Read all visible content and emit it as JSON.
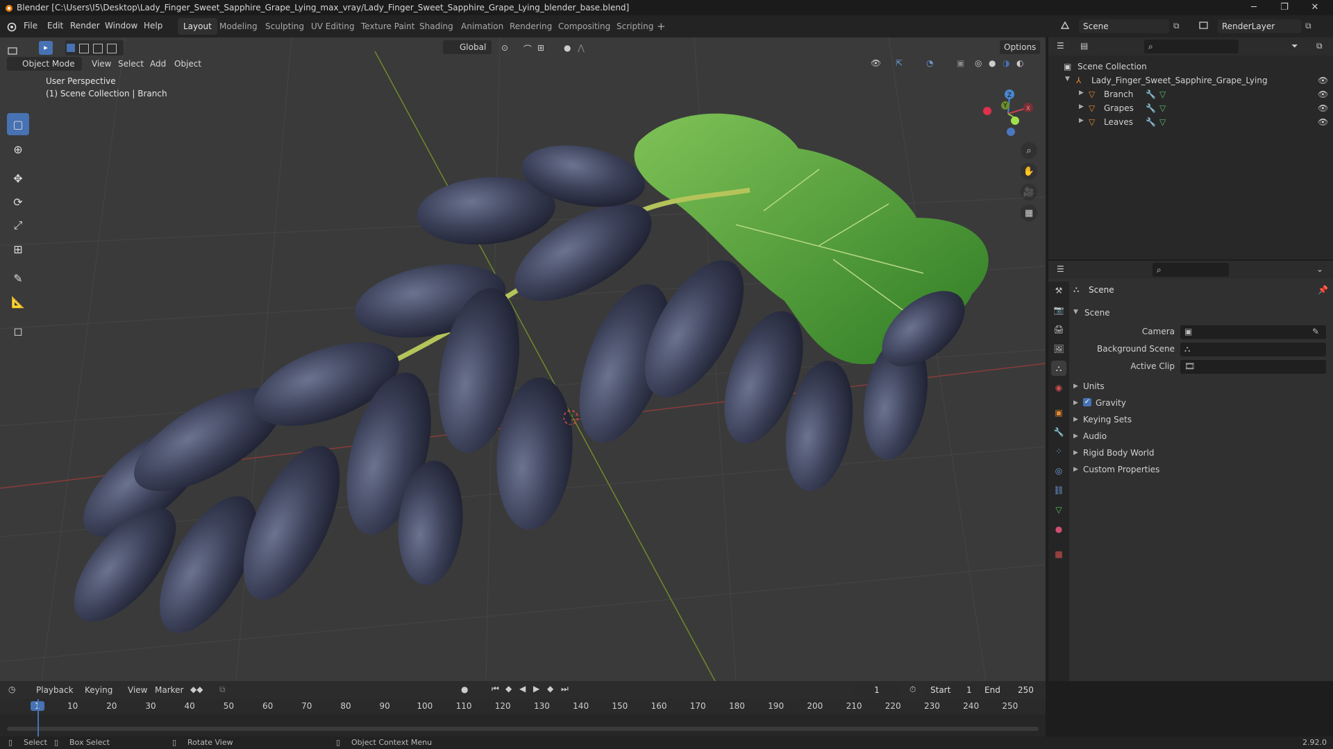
{
  "window": {
    "title": "Blender [C:\\Users\\I5\\Desktop\\Lady_Finger_Sweet_Sapphire_Grape_Lying_max_vray/Lady_Finger_Sweet_Sapphire_Grape_Lying_blender_base.blend]",
    "minimize": "─",
    "maximize": "❐",
    "close": "✕"
  },
  "menu": {
    "items": [
      "File",
      "Edit",
      "Render",
      "Window",
      "Help"
    ],
    "workspaces": [
      "Layout",
      "Modeling",
      "Sculpting",
      "UV Editing",
      "Texture Paint",
      "Shading",
      "Animation",
      "Rendering",
      "Compositing",
      "Scripting"
    ],
    "active_workspace": "Layout",
    "add_workspace": "+",
    "scene_name": "Scene",
    "view_layer": "RenderLayer"
  },
  "viewport": {
    "mode": "Object Mode",
    "menus": [
      "View",
      "Select",
      "Add",
      "Object"
    ],
    "transform_orientation": "Global",
    "options": "Options",
    "perspective_label": "User Perspective",
    "context_label": "(1) Scene Collection | Branch",
    "gizmo": {
      "x": "X",
      "y": "Y",
      "z": "Z"
    }
  },
  "outliner": {
    "root": "Scene Collection",
    "collection": "Lady_Finger_Sweet_Sapphire_Grape_Lying",
    "objects": [
      "Branch",
      "Grapes",
      "Leaves"
    ]
  },
  "properties": {
    "context": "Scene",
    "panel_title": "Scene",
    "fields": [
      {
        "label": "Camera"
      },
      {
        "label": "Background Scene"
      },
      {
        "label": "Active Clip"
      }
    ],
    "panels": [
      "Units",
      "Gravity",
      "Keying Sets",
      "Audio",
      "Rigid Body World",
      "Custom Properties"
    ],
    "gravity_checked": true
  },
  "timeline": {
    "menus": [
      "Playback",
      "Keying",
      "View",
      "Marker"
    ],
    "current_frame": "1",
    "start_label": "Start",
    "start": "1",
    "end_label": "End",
    "end": "250",
    "ticks": [
      "1",
      "10",
      "20",
      "30",
      "40",
      "50",
      "60",
      "70",
      "80",
      "90",
      "100",
      "110",
      "120",
      "130",
      "140",
      "150",
      "160",
      "170",
      "180",
      "190",
      "200",
      "210",
      "220",
      "230",
      "240",
      "250"
    ]
  },
  "statusbar": {
    "select": "Select",
    "box_select": "Box Select",
    "rotate_view": "Rotate View",
    "context_menu": "Object Context Menu",
    "version": "2.92.0"
  },
  "colors": {
    "accent": "#4772b3",
    "x_axis": "#c9404c",
    "y_axis": "#8bc34a",
    "z_axis": "#4a88d0"
  }
}
